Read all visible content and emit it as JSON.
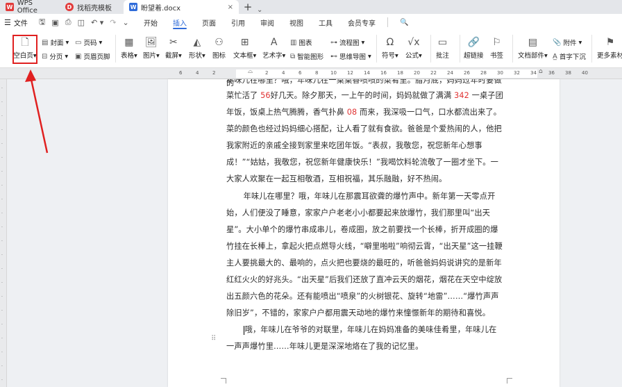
{
  "titlebar": {
    "tabs": [
      {
        "label": "WPS Office",
        "icon": "wps-logo-icon"
      },
      {
        "label": "找稻壳模板",
        "icon": "docer-icon"
      },
      {
        "label": "盼望着.docx",
        "icon": "word-doc-icon",
        "close": "×"
      }
    ],
    "add_tab": "+",
    "more": "⌄"
  },
  "menubar": {
    "file_label": "文件",
    "items": [
      "开始",
      "插入",
      "页面",
      "引用",
      "审阅",
      "视图",
      "工具",
      "会员专享"
    ],
    "active": "插入",
    "search_icon": "🔍"
  },
  "ribbon": {
    "blank_page": "空白页",
    "cover": "封面",
    "page_break": "分页",
    "page_number": "页码",
    "header_footer": "页眉页脚",
    "table": "表格",
    "picture": "图片",
    "screenshot": "截屏",
    "shape": "形状",
    "icon": "图标",
    "textbox": "文本框",
    "wordart": "艺术字",
    "chart": "图表",
    "smart_graphic": "智能图形",
    "flowchart": "流程图",
    "mindmap": "思维导图",
    "symbol": "符号",
    "formula": "公式",
    "comment": "批注",
    "hyperlink": "超链接",
    "bookmark": "书签",
    "doc_parts": "文档部件",
    "attachment": "附件",
    "drop_cap": "首字下沉",
    "more_material": "更多素材"
  },
  "ruler": {
    "numbers": [
      "6",
      "4",
      "2",
      "2",
      "4",
      "6",
      "8",
      "10",
      "12",
      "14",
      "16",
      "18",
      "20",
      "22",
      "24",
      "26",
      "28",
      "30",
      "32",
      "34",
      "36",
      "38",
      "40"
    ]
  },
  "document": {
    "partial_top": "年味儿在哪里？哦，年味儿在一桌桌香喷喷的菜肴里。腊月底，妈妈过年时要做的",
    "p1": [
      {
        "t": "菜忙活了 "
      },
      {
        "t": "56",
        "red": true
      },
      {
        "t": "好几天。除夕那天，一上午的时间，妈妈就做了满满 "
      },
      {
        "t": "342",
        "red": true
      },
      {
        "t": " 一桌子团年饭，饭桌上热气腾腾，香气扑鼻 "
      },
      {
        "t": "08",
        "red": true
      },
      {
        "t": " 而来，我深吸一口气，口水都流出来了。菜的颜色也经过妈妈细心搭配，让人看了就有食欲。爸爸是个爱热闹的人，他把我家附近的亲戚全接到家里来吃团年饭。“表叔，我敬您，祝您新年心想事成！”“姑姑，我敬您，祝您新年健康快乐！”我喝饮料轮流敬了一圈才坐下。一大家人欢聚在一起互相敬酒，互相祝福，其乐融融，好不热闹。"
      }
    ],
    "p2": "年味儿在哪里？哦，年味儿在那震耳欲聋的爆竹声中。新年第一天零点开始，人们便没了睡意，家家户户老老小小都要起来放爆竹，我们那里叫“出天星”。大小单个的爆竹串成串儿，卷成圈，放之前要找一个长棒，折开成圈的爆竹挂在长棒上，拿起火把点燃导火线，“噼里啪啦”响彻云霄，“出天星”这一挂鞭主人要挑最大的、最响的，点火把也要烧的最旺的，听爸爸妈妈说讲究的是新年红红火火的好兆头。“出天星”后我们还放了直冲云天的烟花，烟花在天空中绽放出五颜六色的花朵。还有能喷出“喷泉”的火树银花、旋转“地雷”……“爆竹声声除旧岁”，不错的，家家户户都用震天动地的爆竹来憧憬新年的期待和喜悦。",
    "p3": "哦，年味儿在爷爷的对联里，年味儿在妈妈准备的美味佳肴里，年味儿在一声声爆竹里……年味儿更是深深地烙在了我的记忆里。",
    "drag_handle": "⠿"
  },
  "colors": {
    "accent": "#2f6bd9",
    "highlight_box": "#e02020",
    "number_red": "#e03232"
  }
}
